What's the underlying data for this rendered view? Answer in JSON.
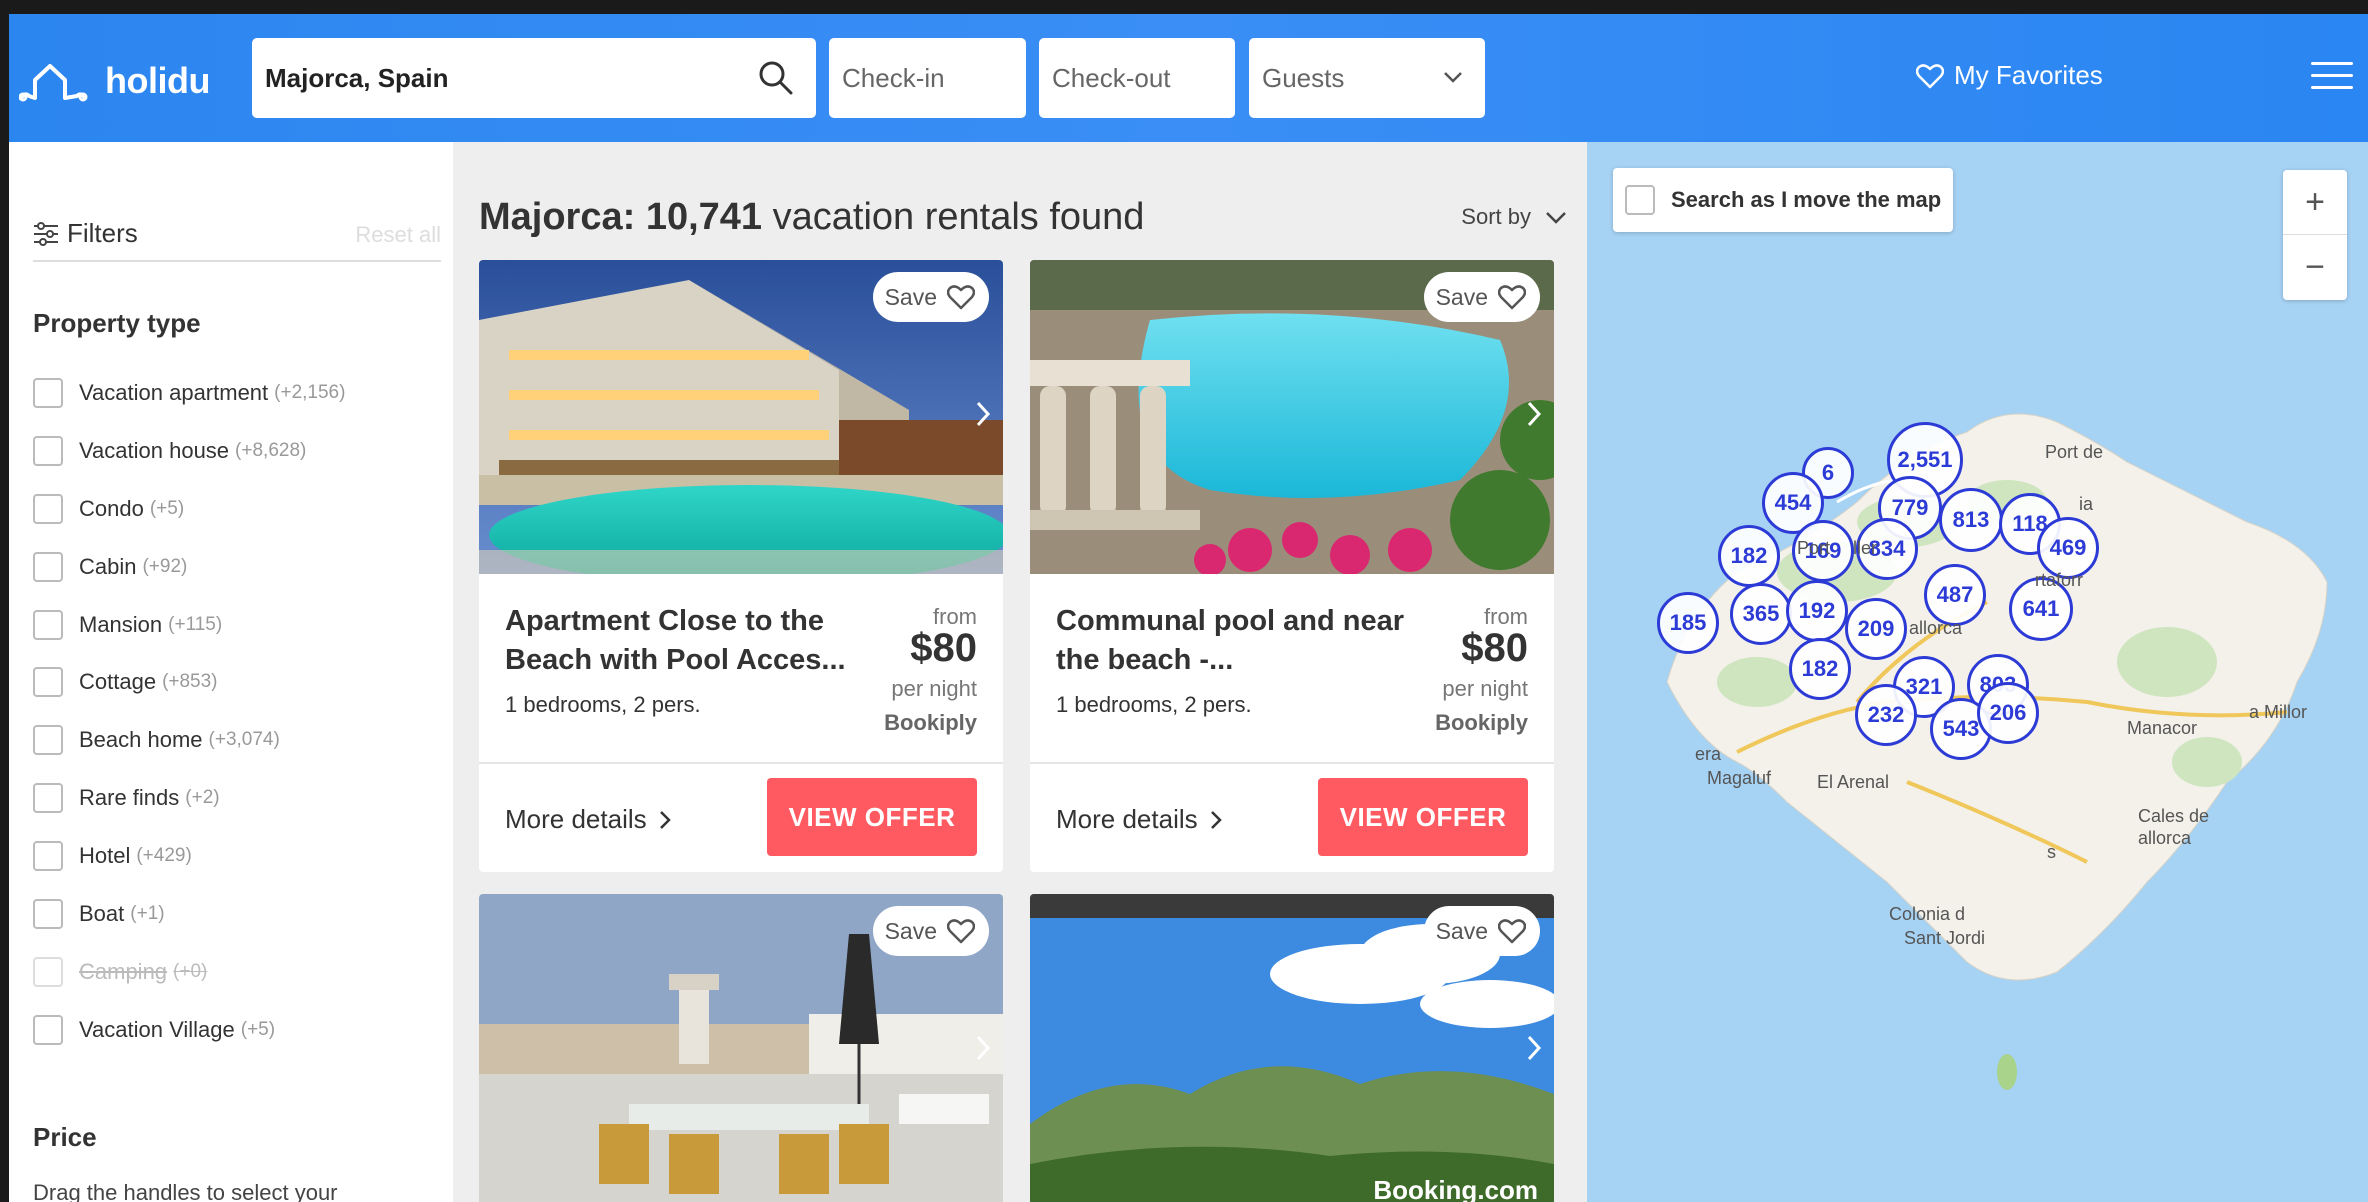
{
  "header": {
    "logo_text": "holidu",
    "destination": "Majorca, Spain",
    "checkin_placeholder": "Check-in",
    "checkout_placeholder": "Check-out",
    "guests_placeholder": "Guests",
    "favorites_label": "My Favorites"
  },
  "sidebar": {
    "filters_label": "Filters",
    "reset_label": "Reset all",
    "property_type_title": "Property type",
    "property_types": [
      {
        "name": "Vacation apartment",
        "count": "(+2,156)",
        "disabled": false
      },
      {
        "name": "Vacation house",
        "count": "(+8,628)",
        "disabled": false
      },
      {
        "name": "Condo",
        "count": "(+5)",
        "disabled": false
      },
      {
        "name": "Cabin",
        "count": "(+92)",
        "disabled": false
      },
      {
        "name": "Mansion",
        "count": "(+115)",
        "disabled": false
      },
      {
        "name": "Cottage",
        "count": "(+853)",
        "disabled": false
      },
      {
        "name": "Beach home",
        "count": "(+3,074)",
        "disabled": false
      },
      {
        "name": "Rare finds",
        "count": "(+2)",
        "disabled": false
      },
      {
        "name": "Hotel",
        "count": "(+429)",
        "disabled": false
      },
      {
        "name": "Boat",
        "count": "(+1)",
        "disabled": false
      },
      {
        "name": "Camping",
        "count": "(+0)",
        "disabled": true
      },
      {
        "name": "Vacation Village",
        "count": "(+5)",
        "disabled": false
      }
    ],
    "price_title": "Price",
    "price_desc": "Drag the handles to select your"
  },
  "results": {
    "title_location": "Majorca:",
    "title_count": "10,741",
    "title_rest": "vacation rentals found",
    "sort_label": "Sort by",
    "cards": [
      {
        "save": "Save",
        "title": "Apartment Close to the Beach with Pool Acces...",
        "meta": "1 bedrooms, 2 pers.",
        "from": "from",
        "price": "$80",
        "per": "per night",
        "provider": "Bookiply",
        "more": "More details",
        "cta": "VIEW OFFER"
      },
      {
        "save": "Save",
        "title": "Communal pool and near the beach -...",
        "meta": "1 bedrooms, 2 pers.",
        "from": "from",
        "price": "$80",
        "per": "per night",
        "provider": "Bookiply",
        "more": "More details",
        "cta": "VIEW OFFER"
      },
      {
        "save": "Save"
      },
      {
        "save": "Save",
        "watermark": "Booking.com"
      }
    ]
  },
  "map": {
    "search_move_label": "Search as I move the map",
    "zoom_in": "+",
    "zoom_out": "−",
    "clusters": [
      "6",
      "2,551",
      "454",
      "779",
      "813",
      "118",
      "469",
      "182",
      "169",
      "834",
      "487",
      "641",
      "185",
      "365",
      "192",
      "209",
      "182",
      "321",
      "803",
      "232",
      "543",
      "206"
    ],
    "places": [
      "Port de",
      "ia",
      "Port",
      "ller",
      "allorca",
      "rtaforr",
      "Manacor",
      "a Millor",
      "era",
      "Magaluf",
      "El Arenal",
      "Cales de",
      "allorca",
      "s",
      "Colonia d",
      "Sant Jordi"
    ]
  },
  "colors": {
    "header_blue": "#2c86f0",
    "cta_red": "#ff5a61",
    "cluster_blue": "#2d3bd6",
    "sea": "#a6d2f4"
  }
}
